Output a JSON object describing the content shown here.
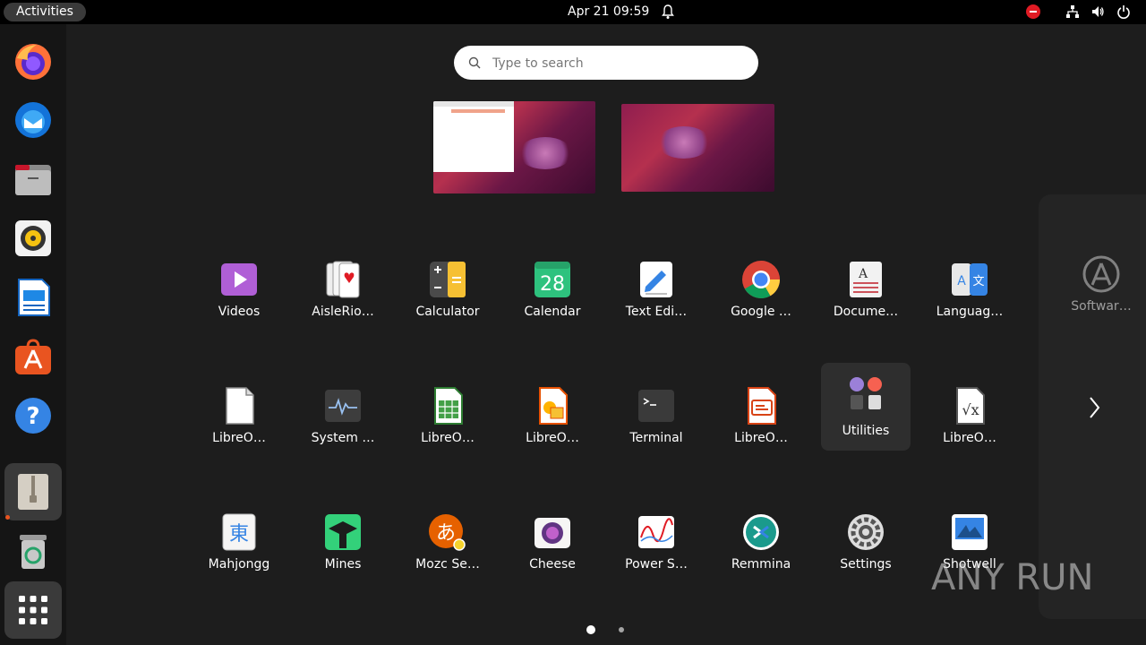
{
  "topbar": {
    "activities_label": "Activities",
    "clock": "Apr 21  09:59",
    "icons": [
      "bell-icon",
      "stop-icon",
      "network-icon",
      "volume-icon",
      "power-icon"
    ]
  },
  "search": {
    "placeholder": "Type to search"
  },
  "dock": {
    "items": [
      "firefox-icon",
      "thunderbird-icon",
      "files-icon",
      "rhythmbox-icon",
      "libreoffice-writer-icon",
      "app-center-icon",
      "help-icon",
      "archive-manager-icon",
      "trash-icon",
      "show-apps-icon"
    ]
  },
  "apps": [
    {
      "label": "Videos",
      "icon": "videos-icon"
    },
    {
      "label": "AisleRio…",
      "icon": "cards-icon"
    },
    {
      "label": "Calculator",
      "icon": "calculator-icon"
    },
    {
      "label": "Calendar",
      "icon": "calendar-icon",
      "badge": "28"
    },
    {
      "label": "Text Edi…",
      "icon": "text-editor-icon"
    },
    {
      "label": "Google …",
      "icon": "chrome-icon"
    },
    {
      "label": "Docume…",
      "icon": "document-viewer-icon"
    },
    {
      "label": "Languag…",
      "icon": "language-icon"
    },
    {
      "label": "LibreO…",
      "icon": "libreoffice-icon"
    },
    {
      "label": "System …",
      "icon": "system-monitor-icon"
    },
    {
      "label": "LibreO…",
      "icon": "libreoffice-calc-icon"
    },
    {
      "label": "LibreO…",
      "icon": "libreoffice-draw-icon"
    },
    {
      "label": "Terminal",
      "icon": "terminal-icon"
    },
    {
      "label": "LibreO…",
      "icon": "libreoffice-impress-icon"
    },
    {
      "label": "Utilities",
      "icon": "utilities-folder-icon"
    },
    {
      "label": "LibreO…",
      "icon": "libreoffice-math-icon"
    },
    {
      "label": "Mahjongg",
      "icon": "mahjongg-icon"
    },
    {
      "label": "Mines",
      "icon": "mines-icon"
    },
    {
      "label": "Mozc Se…",
      "icon": "mozc-icon"
    },
    {
      "label": "Cheese",
      "icon": "cheese-icon"
    },
    {
      "label": "Power S…",
      "icon": "power-statistics-icon"
    },
    {
      "label": "Remmina",
      "icon": "remmina-icon"
    },
    {
      "label": "Settings",
      "icon": "settings-icon"
    },
    {
      "label": "Shotwell",
      "icon": "shotwell-icon"
    }
  ],
  "next_page_app": {
    "label": "Softwar…",
    "icon": "software-icon"
  },
  "pagination": {
    "pages": 2,
    "current": 1
  },
  "watermark": "ANY RUN",
  "colors": {
    "accent": "#e95420",
    "background": "#1d1d1d"
  }
}
